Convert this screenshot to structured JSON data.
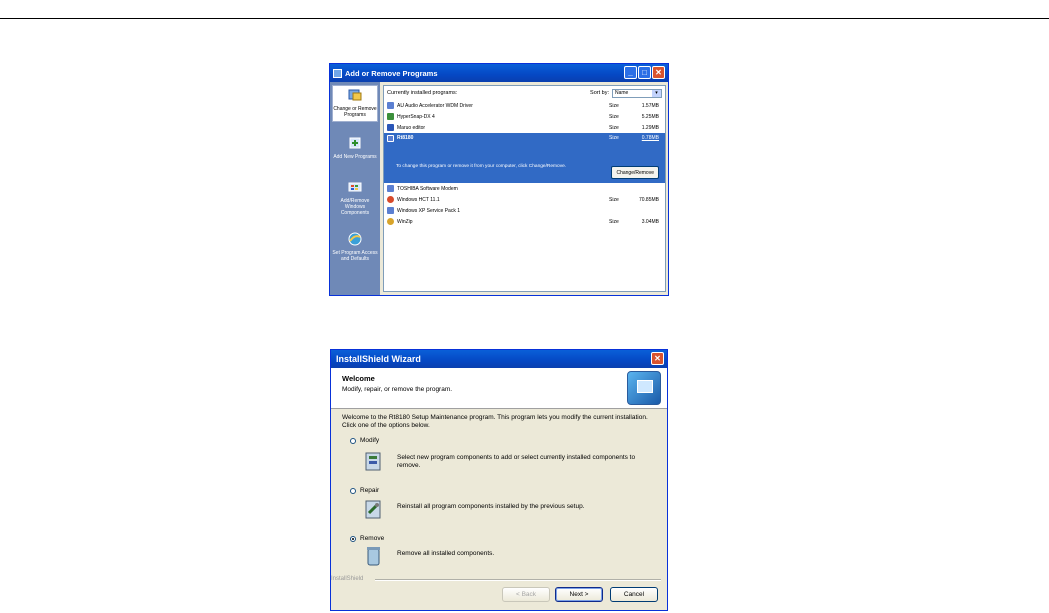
{
  "arp": {
    "title": "Add or Remove Programs",
    "sidebar": [
      {
        "label": "Change or Remove Programs",
        "icon": "change-remove-icon",
        "active": true
      },
      {
        "label": "Add New Programs",
        "icon": "add-new-icon",
        "active": false
      },
      {
        "label": "Add/Remove Windows Components",
        "icon": "windows-components-icon",
        "active": false
      },
      {
        "label": "Set Program Access and Defaults",
        "icon": "program-access-icon",
        "active": false
      }
    ],
    "list_header": "Currently installed programs:",
    "sort_label": "Sort by:",
    "sort_value": "Name",
    "programs": [
      {
        "name": "AU Audio Accelerator WDM Driver",
        "size_label": "Size",
        "size": "1.57MB",
        "color": "#5b7fd1"
      },
      {
        "name": "HyperSnap-DX 4",
        "size_label": "Size",
        "size": "5.25MB",
        "color": "#3b8f3b"
      },
      {
        "name": "Maruo editor",
        "size_label": "Size",
        "size": "1.29MB",
        "color": "#2a56b8"
      },
      {
        "name": "Rt8180",
        "size_label": "Size",
        "size": "0.78MB",
        "color": "#5b7fd1",
        "selected": true
      },
      {
        "name": "TOSHIBA Software Modem",
        "size_label": "",
        "size": "",
        "color": "#5b7fd1"
      },
      {
        "name": "Windows HCT 11.1",
        "size_label": "Size",
        "size": "70.85MB",
        "color": "#d84a2a"
      },
      {
        "name": "Windows XP Service Pack 1",
        "size_label": "",
        "size": "",
        "color": "#5b7fd1"
      },
      {
        "name": "WinZip",
        "size_label": "Size",
        "size": "3.04MB",
        "color": "#d8a42a"
      }
    ],
    "selected_desc": "To change this program or remove it from your computer, click Change/Remove.",
    "change_remove_button": "Change/Remove"
  },
  "wizard": {
    "title": "InstallShield Wizard",
    "banner_title": "Welcome",
    "banner_sub": "Modify, repair, or remove the program.",
    "intro": "Welcome to the Rt8180 Setup Maintenance program. This program lets you modify the current installation. Click one of the options below.",
    "options": [
      {
        "label": "Modify",
        "desc": "Select new program components to add or select currently installed components to remove.",
        "selected": false
      },
      {
        "label": "Repair",
        "desc": "Reinstall all program components installed by the previous setup.",
        "selected": false
      },
      {
        "label": "Remove",
        "desc": "Remove all installed components.",
        "selected": true
      }
    ],
    "footer_brand": "InstallShield",
    "buttons": {
      "back": "< Back",
      "next": "Next >",
      "cancel": "Cancel"
    }
  }
}
